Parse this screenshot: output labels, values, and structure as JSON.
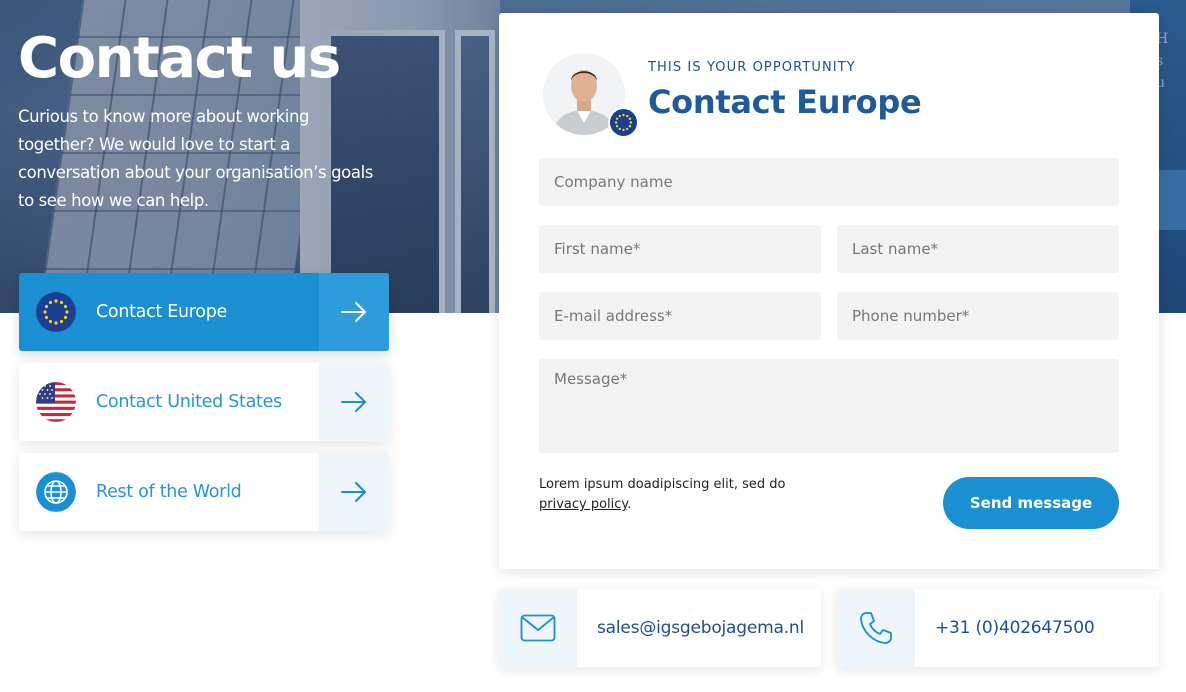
{
  "hero": {
    "title": "Contact us",
    "text": "Curious to know more about working together? We would love to start a conversation about your organisation’s goals to see how we can help."
  },
  "regions": [
    {
      "label": "Contact Europe",
      "icon": "eu-flag-icon",
      "active": true
    },
    {
      "label": "Contact United States",
      "icon": "us-flag-icon",
      "active": false
    },
    {
      "label": "Rest of the World",
      "icon": "globe-icon",
      "active": false
    }
  ],
  "form": {
    "kicker": "THIS IS YOUR OPPORTUNITY",
    "title": "Contact Europe",
    "placeholders": {
      "company": "Company name",
      "first_name": "First name*",
      "last_name": "Last name*",
      "email": "E-mail address*",
      "phone": "Phone number*",
      "message": "Message*"
    },
    "legal_text": "Lorem ipsum doadipiscing elit, sed do",
    "privacy_link": "privacy policy",
    "legal_suffix": ".",
    "send_label": "Send message"
  },
  "contact": {
    "email": "sales@igsgebojagema.nl",
    "phone": "+31 (0)402647500"
  },
  "colors": {
    "accent": "#1a8fd1",
    "title_blue": "#1f5a99",
    "light_tint": "#eef6fc",
    "field_bg": "#f3f3f3"
  }
}
